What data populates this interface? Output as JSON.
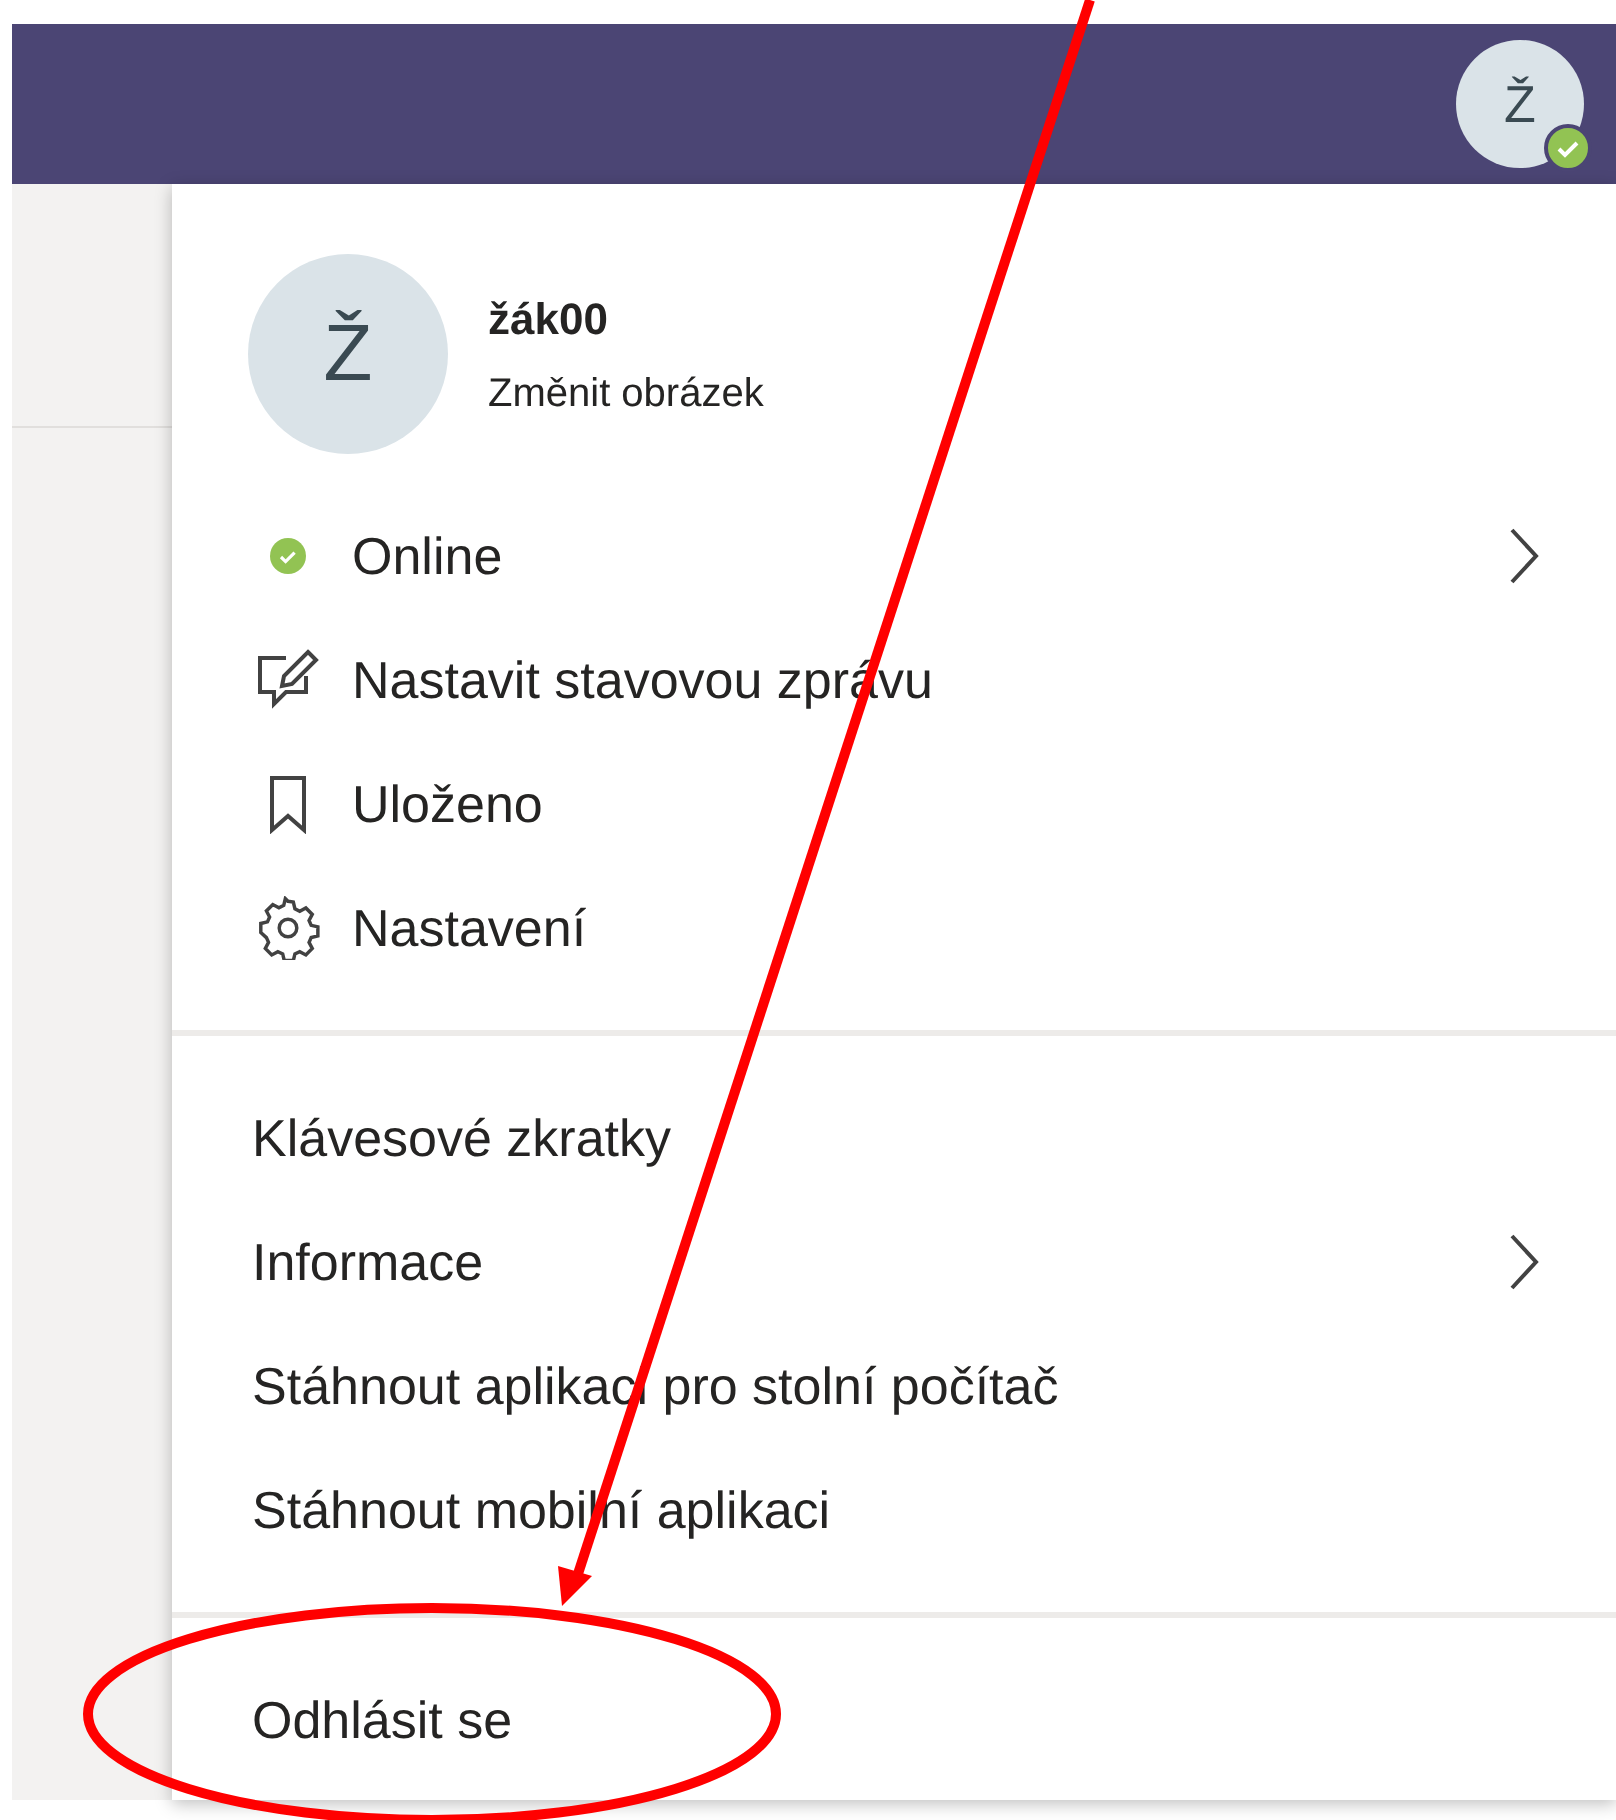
{
  "header": {
    "avatar_initial": "Ž",
    "online": true
  },
  "profile": {
    "initial": "Ž",
    "name": "žák00",
    "link": "Změnit obrázek"
  },
  "sections": [
    {
      "items": [
        {
          "kind": "status",
          "label": "Online",
          "submenu": true
        },
        {
          "kind": "message",
          "label": "Nastavit stavovou zprávu",
          "submenu": false
        },
        {
          "kind": "saved",
          "label": "Uloženo",
          "submenu": false
        },
        {
          "kind": "settings",
          "label": "Nastavení",
          "submenu": false
        }
      ]
    },
    {
      "items": [
        {
          "kind": "plain",
          "label": "Klávesové zkratky",
          "submenu": false
        },
        {
          "kind": "plain",
          "label": "Informace",
          "submenu": true
        },
        {
          "kind": "plain",
          "label": "Stáhnout aplikaci pro stolní počítač",
          "submenu": false
        },
        {
          "kind": "plain",
          "label": "Stáhnout mobilní aplikaci",
          "submenu": false
        }
      ]
    },
    {
      "items": [
        {
          "kind": "plain",
          "label": "Odhlásit se",
          "submenu": false
        }
      ]
    }
  ]
}
